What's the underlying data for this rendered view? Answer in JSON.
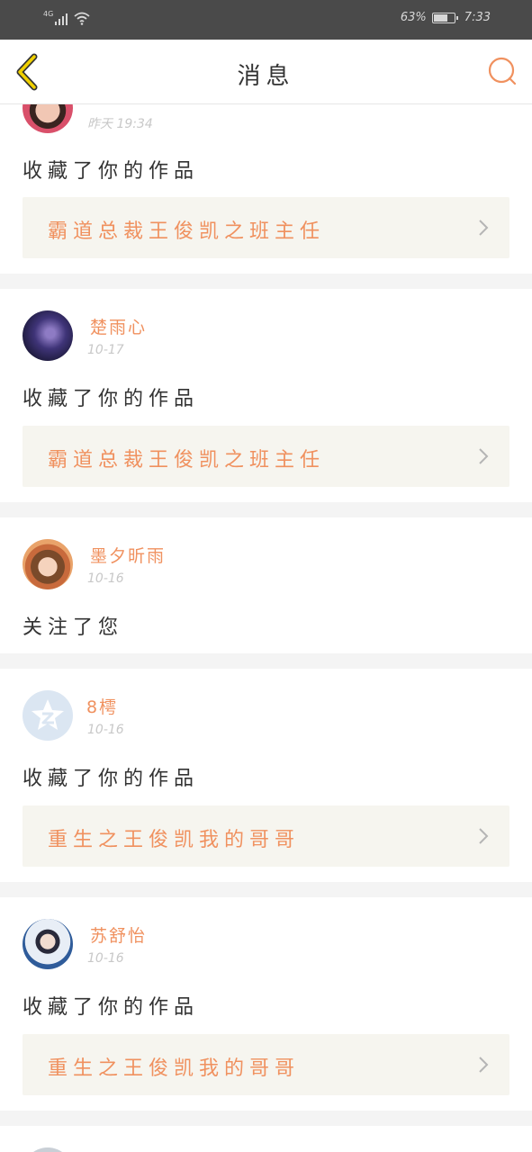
{
  "status_bar": {
    "network": "4G",
    "battery_percent": "63%",
    "battery_level": 0.63,
    "time": "7:33"
  },
  "header": {
    "title": "消息",
    "accent_color": "#f0915f",
    "back_icon": "chevron-left-icon",
    "search_icon": "search-icon"
  },
  "notifications": [
    {
      "user": "",
      "date": "昨天 19:34",
      "action": "收藏了你的作品",
      "work_title": "霸道总裁王俊凯之班主任"
    },
    {
      "user": "楚雨心",
      "date": "10-17",
      "action": "收藏了你的作品",
      "work_title": "霸道总裁王俊凯之班主任"
    },
    {
      "user": "墨夕昕雨",
      "date": "10-16",
      "action": "关注了您"
    },
    {
      "user": "8樗",
      "date": "10-16",
      "action": "收藏了你的作品",
      "work_title": "重生之王俊凯我的哥哥"
    },
    {
      "user": "苏舒怡",
      "date": "10-16",
      "action": "收藏了你的作品",
      "work_title": "重生之王俊凯我的哥哥"
    }
  ]
}
